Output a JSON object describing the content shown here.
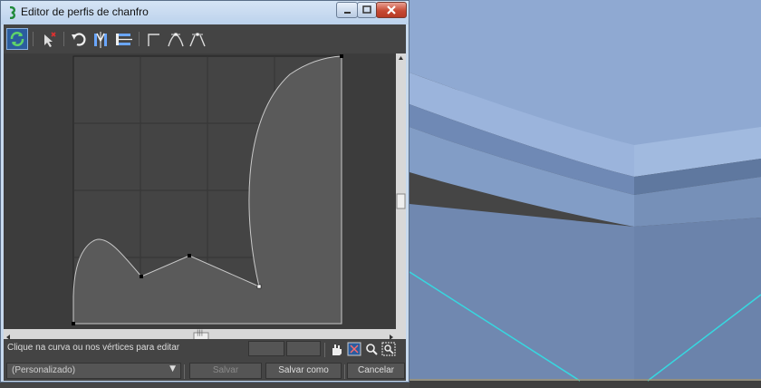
{
  "window": {
    "title": "Editor de perfis de chanfro",
    "minimize": "minimize",
    "maximize": "maximize",
    "close": "close"
  },
  "toolbar": {
    "icons": [
      "refresh-icon",
      "select-delete-icon",
      "undo-icon",
      "mirror-icon",
      "flip-icon",
      "corner-point-icon",
      "bezier-smooth-icon",
      "bezier-corner-icon"
    ]
  },
  "status": {
    "hint": "Clique na curva ou nos vértices para editar",
    "x_value": "",
    "y_value": ""
  },
  "view_tools": [
    "pan-icon",
    "zoom-extents-icon",
    "zoom-icon",
    "zoom-region-icon"
  ],
  "bottom": {
    "preset": "(Personalizado)",
    "save": "Salvar",
    "save_as": "Salvar como",
    "cancel": "Cancelar"
  },
  "scrollbar": {
    "thumb_glyph": "|||"
  },
  "colors": {
    "viewport_bg": "#444444",
    "model_fill": "#7c98c0",
    "selection_edges": "#36d8e0",
    "dialog_frame": "#c7d9ee",
    "profile_fill": "#5a5a5a",
    "profile_stroke": "#c9c9c9"
  }
}
